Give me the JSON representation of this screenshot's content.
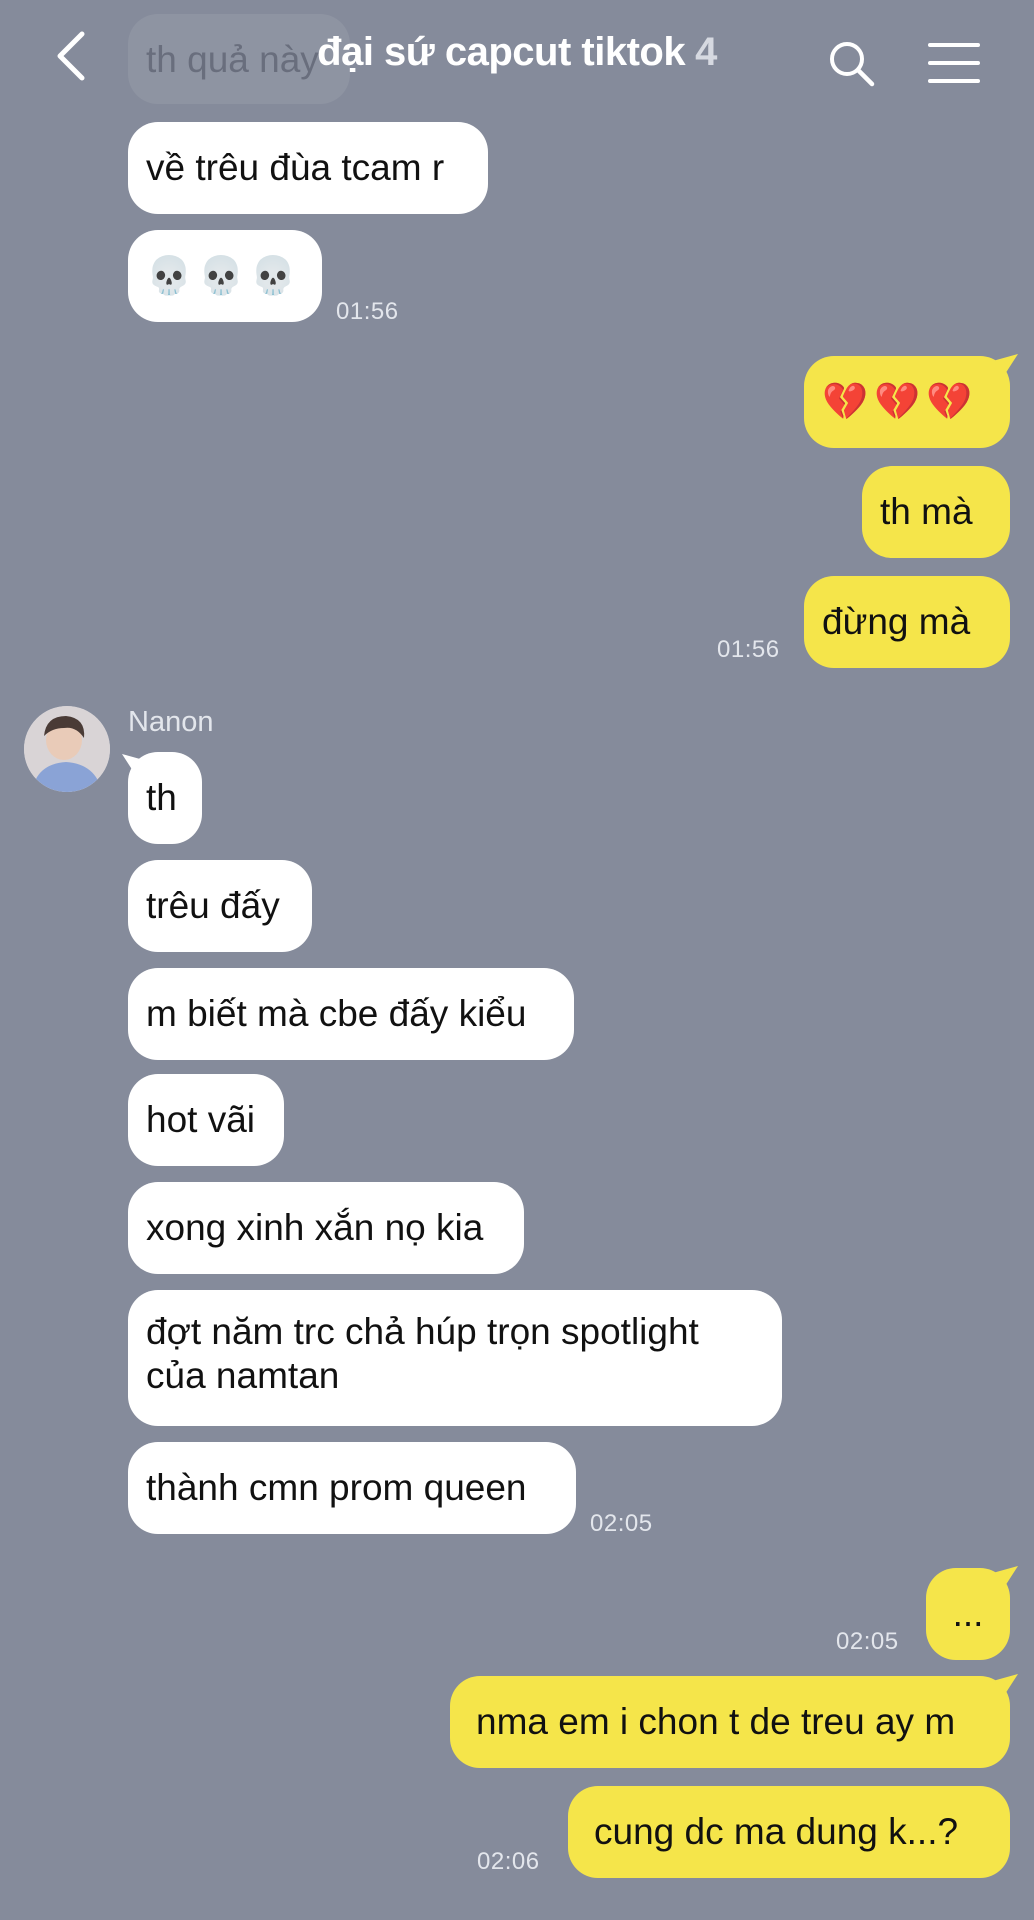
{
  "header": {
    "title": "đại sứ capcut tiktok",
    "member_count": "4",
    "back_icon": "chevron-left-icon",
    "search_icon": "search-icon",
    "menu_icon": "hamburger-menu-icon"
  },
  "colors": {
    "background": "#858b9b",
    "incoming_bubble": "#ffffff",
    "outgoing_bubble": "#f5e54a",
    "timestamp": "#e3e6ec"
  },
  "messages": [
    {
      "text": "th quả này",
      "direction": "incoming"
    },
    {
      "text": "về trêu đùa tcam r",
      "direction": "incoming"
    },
    {
      "text": "💀💀💀",
      "direction": "incoming",
      "time": "01:56"
    },
    {
      "text": "💔💔💔",
      "direction": "outgoing"
    },
    {
      "text": "th mà",
      "direction": "outgoing"
    },
    {
      "text": "đừng mà",
      "direction": "outgoing",
      "time": "01:56"
    },
    {
      "sender": "Nanon",
      "text": "th",
      "direction": "incoming"
    },
    {
      "text": "trêu đấy",
      "direction": "incoming"
    },
    {
      "text": "m biết mà cbe đấy kiểu",
      "direction": "incoming"
    },
    {
      "text": "hot vãi",
      "direction": "incoming"
    },
    {
      "text": "xong xinh xắn nọ kia",
      "direction": "incoming"
    },
    {
      "text_line1": "đợt năm trc chả húp trọn spotlight",
      "text_line2": "của namtan",
      "direction": "incoming"
    },
    {
      "text": "thành cmn prom queen",
      "direction": "incoming",
      "time": "02:05"
    },
    {
      "text": "...",
      "direction": "outgoing",
      "time": "02:05"
    },
    {
      "text": "nma em i chon t de treu ay m",
      "direction": "outgoing"
    },
    {
      "text": "cung dc ma dung k...?",
      "direction": "outgoing",
      "time": "02:06"
    }
  ]
}
